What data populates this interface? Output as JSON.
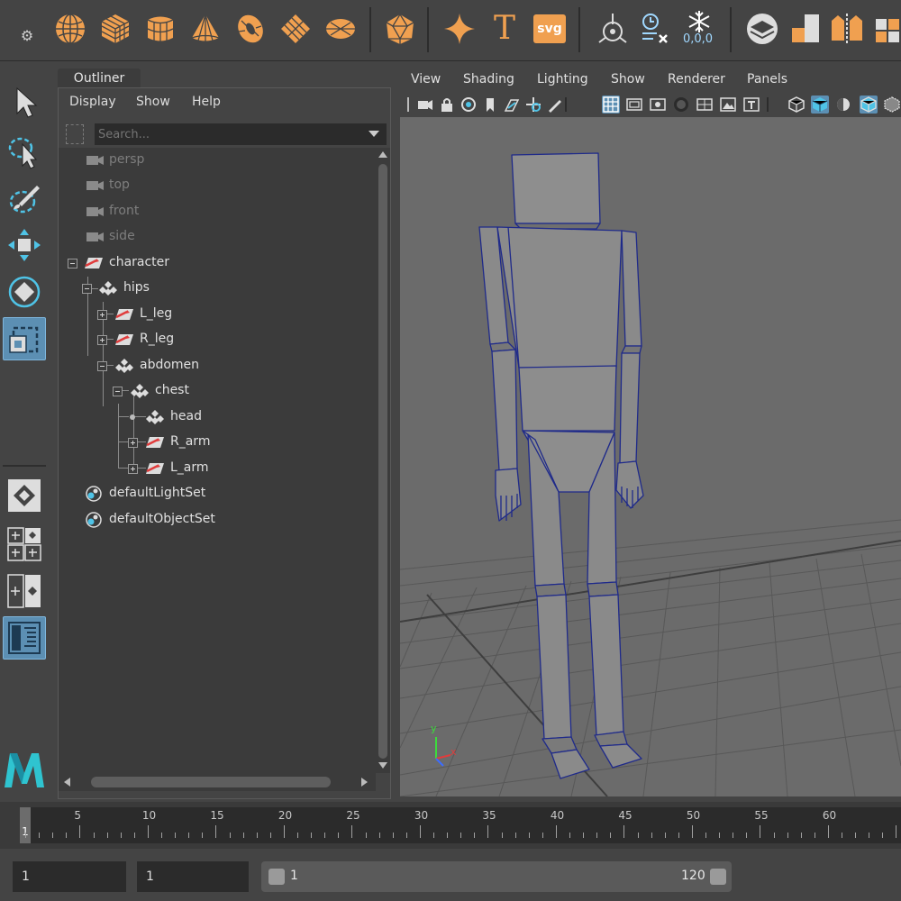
{
  "shelf": {
    "icons": [
      "sphere-icon",
      "cube-icon",
      "cylinder-icon",
      "cone-icon",
      "torus-icon",
      "plane-icon",
      "disc-icon",
      "platonic-icon",
      "star-icon",
      "text-icon",
      "svg-icon",
      "pivot-icon",
      "clock-icon",
      "snowflake-icon",
      "layer-icon",
      "tiles-icon",
      "split-icon",
      "extra-icon"
    ],
    "text_label": "T",
    "svg_label": "svg",
    "coords_label": "0,0,0"
  },
  "outliner": {
    "tab_label": "Outliner",
    "menu": [
      "Display",
      "Show",
      "Help"
    ],
    "search_placeholder": "Search...",
    "rows": [
      {
        "label": "persp",
        "type": "camera",
        "dim": true
      },
      {
        "label": "top",
        "type": "camera",
        "dim": true
      },
      {
        "label": "front",
        "type": "camera",
        "dim": true
      },
      {
        "label": "side",
        "type": "camera",
        "dim": true
      },
      {
        "label": "character",
        "type": "joint-mesh"
      },
      {
        "label": "hips",
        "type": "group"
      },
      {
        "label": "L_leg",
        "type": "joint-mesh"
      },
      {
        "label": "R_leg",
        "type": "joint-mesh"
      },
      {
        "label": "abdomen",
        "type": "group"
      },
      {
        "label": "chest",
        "type": "group"
      },
      {
        "label": "head",
        "type": "group"
      },
      {
        "label": "R_arm",
        "type": "joint-mesh"
      },
      {
        "label": "L_arm",
        "type": "joint-mesh"
      },
      {
        "label": "defaultLightSet",
        "type": "set"
      },
      {
        "label": "defaultObjectSet",
        "type": "set"
      }
    ]
  },
  "viewport": {
    "menu": [
      "View",
      "Shading",
      "Lighting",
      "Show",
      "Renderer",
      "Panels"
    ],
    "axis_labels": {
      "y": "y",
      "x": "x"
    }
  },
  "timeline": {
    "ticks": [
      "5",
      "10",
      "15",
      "20",
      "25",
      "30",
      "35",
      "40",
      "45",
      "50",
      "55",
      "60"
    ],
    "current_frame": "1"
  },
  "range": {
    "start_field": "1",
    "current_field": "1",
    "range_start": "1",
    "range_end": "120"
  },
  "colors": {
    "accent_orange": "#f0a050",
    "accent_blue": "#5c8fb3",
    "maya_logo": "#2fc4d0"
  }
}
